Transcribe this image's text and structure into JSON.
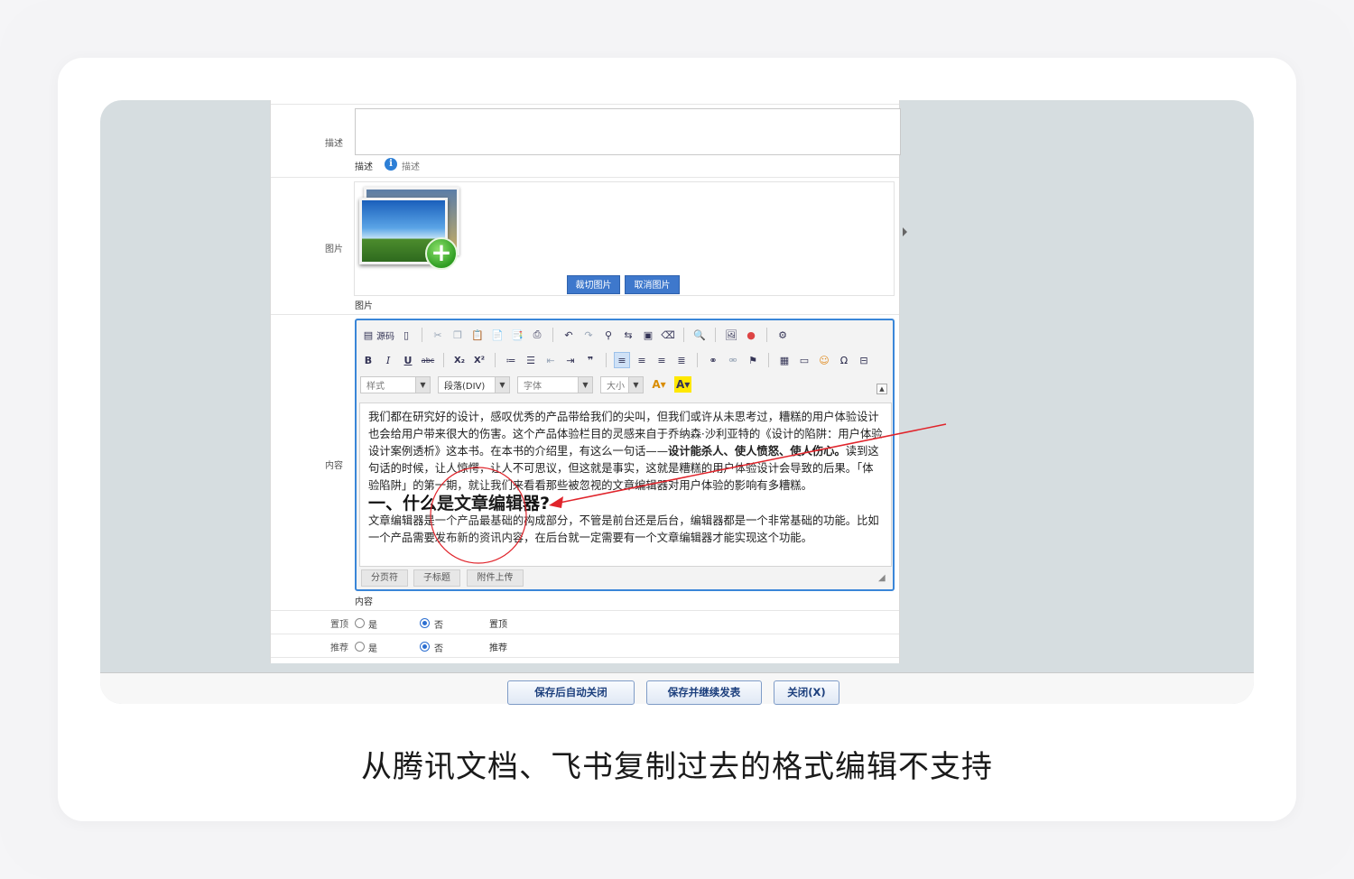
{
  "form": {
    "desc_label": "描述",
    "desc_hint_label": "描述",
    "desc_hint_text": "描述",
    "image_label": "图片",
    "image_hint": "图片",
    "crop_btn": "裁切图片",
    "cancel_btn": "取消图片",
    "content_label": "内容",
    "content_hint": "内容",
    "top_label": "置顶",
    "top_hint": "置顶",
    "recommend_label": "推荐",
    "recommend_hint": "推荐",
    "yes": "是",
    "no": "否"
  },
  "editor": {
    "source_label": "源码",
    "style_dd": "样式",
    "para_dd": "段落(DIV)",
    "font_dd": "字体",
    "size_dd": "大小",
    "para1_a": "我们都在研究好的设计，感叹优秀的产品带给我们的尖叫，但我们或许从未思考过，糟糕的用户体验设计也会给用户带来很大的伤害。这个产品体验栏目的灵感来自于乔纳森·沙利亚特的《设计的陷阱：用户体验设计案例透析》这本书。在本书的介绍里，有这么一句话——",
    "para1_bold": "设计能杀人、使人愤怒、使人伤心。",
    "para1_b": "读到这句话的时候，让人惊愕，让人不可思议，但这就是事实，这就是糟糕的用户体验设计会导致的后果。「体验陷阱」的第一期，就让我们来看看那些被忽视的文章编辑器对用户体验的影响有多糟糕。",
    "heading": "一、什么是文章编辑器?",
    "para2": "文章编辑器是一个产品最基础的构成部分，不管是前台还是后台，编辑器都是一个非常基础的功能。比如一个产品需要发布新的资讯内容，在后台就一定需要有一个文章编辑器才能实现这个功能。",
    "foot_btn1": "分页符",
    "foot_btn2": "子标题",
    "foot_btn3": "附件上传"
  },
  "buttons": {
    "save_close": "保存后自动关闭",
    "save_continue": "保存并继续发表",
    "close": "关闭(X)"
  },
  "caption": "从腾讯文档、飞书复制过去的格式编辑不支持",
  "annotation_color": "#e0242b"
}
